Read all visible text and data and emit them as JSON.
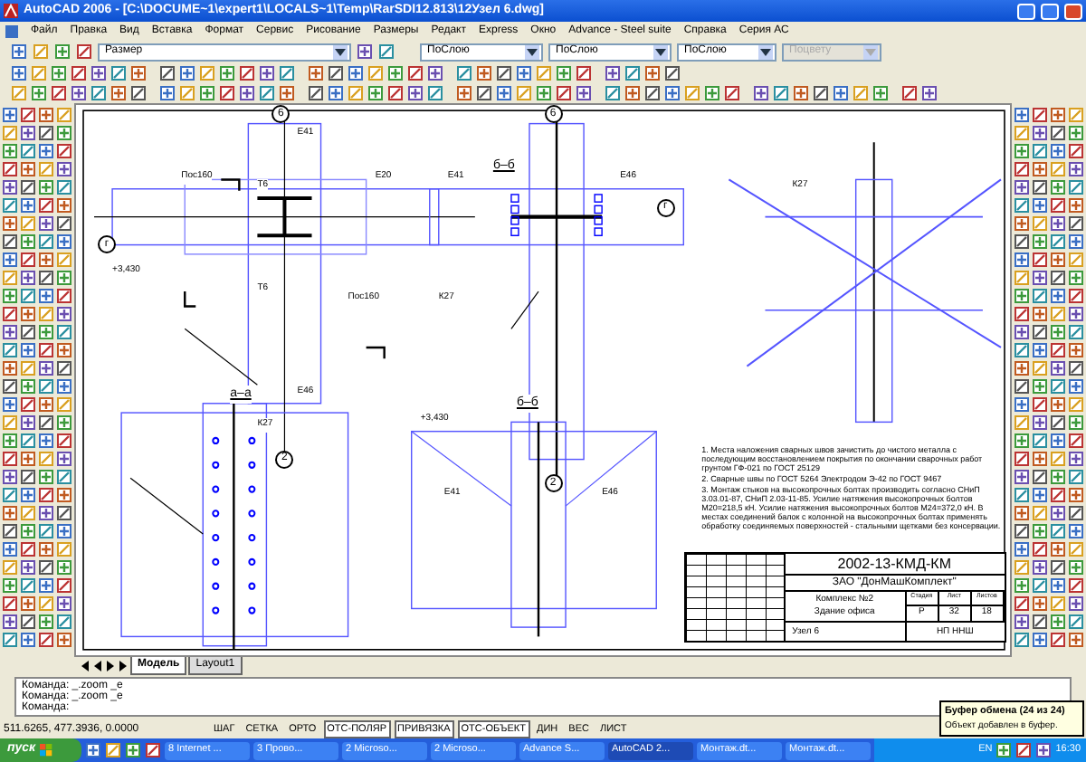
{
  "window": {
    "title": "AutoCAD 2006 - [C:\\DOCUME~1\\expert1\\LOCALS~1\\Temp\\RarSDI12.813\\12Узел 6.dwg]"
  },
  "menu": [
    "Файл",
    "Правка",
    "Вид",
    "Вставка",
    "Формат",
    "Сервис",
    "Рисование",
    "Размеры",
    "Редакт",
    "Express",
    "Окно",
    "Advance - Steel suite",
    "Справка",
    "Серия АС"
  ],
  "properties_bar": {
    "layer": "Размер",
    "color_control": "ПоСлою",
    "linetype": "ПоСлою",
    "lineweight": "ПоСлою",
    "plotstyle": {
      "text": "Поцвету",
      "disabled": true
    }
  },
  "drawing": {
    "views": [
      {
        "title": "б–б"
      },
      {
        "title": "а–а"
      },
      {
        "title": "б–б"
      }
    ],
    "markers": [
      "6",
      "6",
      "г",
      "2",
      "2",
      "г"
    ],
    "labels": [
      "Е41",
      "Е46",
      "Пос160",
      "Пос160",
      "+3,430",
      "Т6",
      "Т6",
      "К27",
      "Е20",
      "Е41",
      "Е46",
      "К27",
      "Е41",
      "Е46",
      "+3,430",
      "К27"
    ],
    "notes": [
      "1. Места наложения сварных швов зачистить до чистого металла с последующим восстановлением покрытия по окончании сварочных работ грунтом ГФ-021 по ГОСТ 25129",
      "2. Сварные швы по ГОСТ 5264 Электродом Э-42 по ГОСТ 9467",
      "3. Монтаж стыков на высокопрочных болтах производить согласно СНиП 3.03.01-87, СНиП 2.03-11-85. Усилие натяжения высокопрочных болтов М20=218,5 кН. Усилие натяжения высокопрочных болтов М24=372,0 кН. В местах соединений балок с колонной на высокопрочных болтах применять обработку соединяемых поверхностей - стальными щетками без консервации."
    ],
    "title_block": {
      "code": "2002-13-КМД-КМ",
      "company": "ЗАО \"ДонМашКомплект\"",
      "object": "Комплекс №2",
      "building": "Здание офиса",
      "headers": [
        "Стадия",
        "Лист",
        "Листов"
      ],
      "values": [
        "Р",
        "32",
        "18"
      ],
      "sheet": "Узел 6",
      "org": "НП ННШ"
    }
  },
  "layout_tabs": [
    {
      "label": "Модель",
      "selected": true
    },
    {
      "label": "Layout1",
      "selected": false
    }
  ],
  "command_lines": [
    "Команда: _.zoom _e",
    "Команда: _.zoom _e",
    "Команда:"
  ],
  "status_bar": {
    "coordinates": "511.6265, 477.3936, 0.0000",
    "toggles": [
      {
        "label": "ШАГ",
        "on": false
      },
      {
        "label": "СЕТКА",
        "on": false
      },
      {
        "label": "ОРТО",
        "on": false
      },
      {
        "label": "ОТС-ПОЛЯР",
        "on": true
      },
      {
        "label": "ПРИВЯЗКА",
        "on": true
      },
      {
        "label": "ОТС-ОБЪЕКТ",
        "on": true
      },
      {
        "label": "ДИН",
        "on": false
      },
      {
        "label": "ВЕС",
        "on": false
      },
      {
        "label": "ЛИСТ",
        "on": false
      }
    ]
  },
  "balloon": {
    "title": "Буфер обмена (24 из 24)",
    "text": "Объект добавлен в буфер."
  },
  "taskbar": {
    "start": "пуск",
    "tasks": [
      {
        "label": "8 Internet ...",
        "selected": false
      },
      {
        "label": "3 Прово...",
        "selected": false
      },
      {
        "label": "2 Microso...",
        "selected": false
      },
      {
        "label": "2 Microso...",
        "selected": false
      },
      {
        "label": "Advance S...",
        "selected": false
      },
      {
        "label": "AutoCAD 2...",
        "selected": true
      },
      {
        "label": "Монтаж.dt...",
        "selected": false
      },
      {
        "label": "Монтаж.dt...",
        "selected": false
      }
    ],
    "language": "EN",
    "clock": "16:30"
  }
}
